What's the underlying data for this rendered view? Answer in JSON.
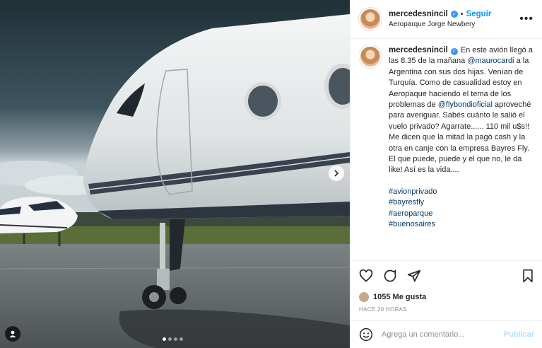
{
  "post": {
    "username": "mercedesnincil",
    "follow_label": "Seguir",
    "separator": "•",
    "location": "Aeroparque Jorge Newbery",
    "more_label": "•••"
  },
  "caption": {
    "username": "mercedesnincil",
    "line1": "En este avión llegó a las 8.35 de la mañana ",
    "mention1": "@maurocardi",
    "line2": " a la Argentina con sus dos hijas. Venían de Turquía. Como de casualidad estoy en Aeropaque haciendo el tema de los problemas de ",
    "mention2": "@flybondioficial",
    "line3": " aproveché para averiguar. Sabés cuánto le salió el vuelo privado? Agarrate...... 110 mil u$s!!",
    "line4": "Me dicen que la mitad la pagó cash y la otra en canje con la empresa Bayres Fly.",
    "line5": "El que puede, puede y el que no, le da like! Así es la vida....",
    "hashtags": [
      "#avionprivado",
      "#bayresfly",
      "#aeroparque",
      "#buenosaires"
    ]
  },
  "stats": {
    "likes_count": "1055",
    "likes_label": "Me gusta",
    "time": "HACE 20 HORAS"
  },
  "comment": {
    "placeholder": "Agrega un comentario...",
    "publish_label": "Publicar"
  },
  "colors": {
    "link": "#0095f6",
    "mention": "#00376b",
    "verified": "#3897f0"
  },
  "carousel": {
    "slides": 4,
    "active": 1
  }
}
